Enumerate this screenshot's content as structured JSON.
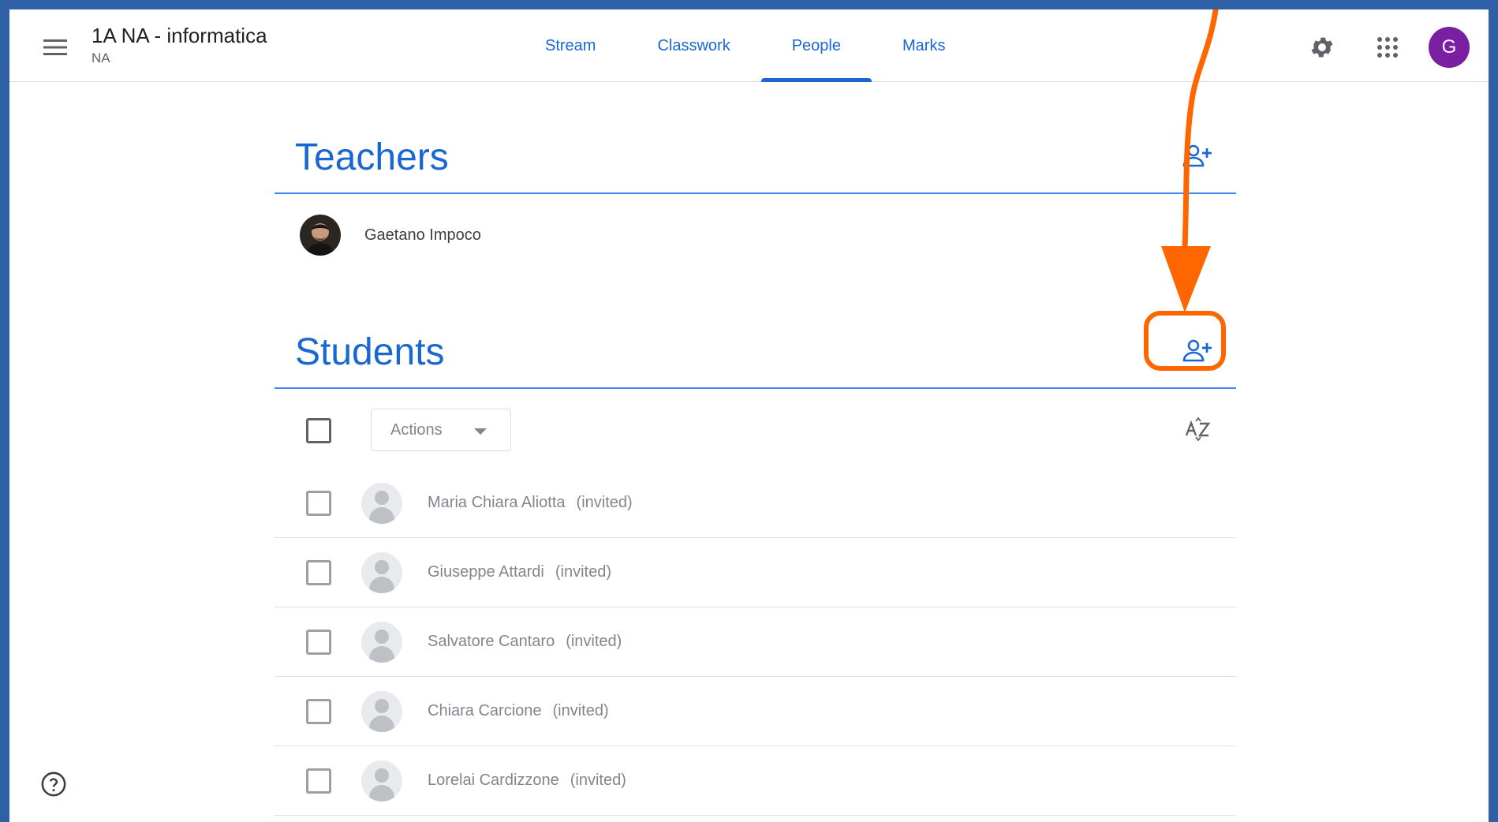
{
  "header": {
    "class_title": "1A NA - informatica",
    "class_section": "NA",
    "avatar_letter": "G",
    "tabs": [
      {
        "label": "Stream"
      },
      {
        "label": "Classwork"
      },
      {
        "label": "People",
        "active": true
      },
      {
        "label": "Marks"
      }
    ]
  },
  "teachers": {
    "title": "Teachers",
    "list": [
      {
        "name": "Gaetano Impoco"
      }
    ]
  },
  "students": {
    "title": "Students",
    "actions_label": "Actions",
    "list": [
      {
        "name": "Maria Chiara Aliotta",
        "status": "(invited)"
      },
      {
        "name": "Giuseppe Attardi",
        "status": "(invited)"
      },
      {
        "name": "Salvatore Cantaro",
        "status": "(invited)"
      },
      {
        "name": "Chiara Carcione",
        "status": "(invited)"
      },
      {
        "name": "Lorelai Cardizzone",
        "status": "(invited)"
      }
    ]
  },
  "icons": {
    "menu": "menu-icon",
    "settings": "gear-icon",
    "apps": "apps-grid-icon",
    "add_person": "person-add-icon",
    "sort": "sort-az-icon",
    "help": "help-icon"
  },
  "colors": {
    "accent": "#1967d2",
    "divider": "#4285f4",
    "avatar": "#7b1fa2",
    "annotation": "#ff6600",
    "frame": "#2f5fa5"
  }
}
